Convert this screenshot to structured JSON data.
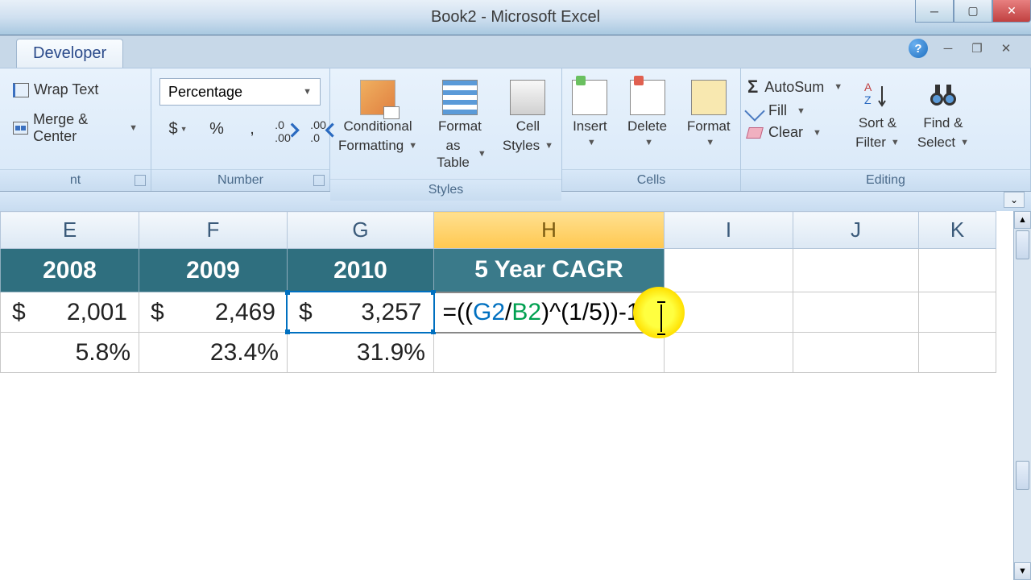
{
  "titlebar": {
    "text": "Book2 - Microsoft Excel"
  },
  "tab": {
    "label": "Developer"
  },
  "ribbon": {
    "alignment": {
      "wrap": "Wrap Text",
      "merge": "Merge & Center",
      "label": "nt"
    },
    "number": {
      "format": "Percentage",
      "dollar": "$",
      "percent": "%",
      "comma": ",",
      "inc": ".0→.00",
      "dec": ".00→.0",
      "label": "Number"
    },
    "styles": {
      "cond1": "Conditional",
      "cond2": "Formatting",
      "fmt1": "Format",
      "fmt2": "as Table",
      "cell1": "Cell",
      "cell2": "Styles",
      "label": "Styles"
    },
    "cells": {
      "insert": "Insert",
      "delete": "Delete",
      "format": "Format",
      "label": "Cells"
    },
    "editing": {
      "autosum": "AutoSum",
      "fill": "Fill",
      "clear": "Clear",
      "sort1": "Sort &",
      "sort2": "Filter",
      "find1": "Find &",
      "find2": "Select",
      "label": "Editing"
    }
  },
  "columns": {
    "E": "E",
    "F": "F",
    "G": "G",
    "H": "H",
    "I": "I",
    "J": "J",
    "K": "K"
  },
  "headers": {
    "E": "2008",
    "F": "2009",
    "G": "2010",
    "H": "5 Year CAGR"
  },
  "row2": {
    "E_sym": "$",
    "E_val": "2,001",
    "F_sym": "$",
    "F_val": "2,469",
    "G_sym": "$",
    "G_val": "3,257",
    "H_formula_prefix": "=((",
    "H_formula_g": "G2",
    "H_formula_slash": "/",
    "H_formula_b": "B2",
    "H_formula_mid": ")^(1/5))",
    "H_formula_suffix": "-1"
  },
  "row3": {
    "E": "5.8%",
    "F": "23.4%",
    "G": "31.9%"
  },
  "chart_data": {
    "type": "table",
    "columns": [
      "E",
      "F",
      "G",
      "H"
    ],
    "header_row": [
      "2008",
      "2009",
      "2010",
      "5 Year CAGR"
    ],
    "data_rows": [
      {
        "E": 2001,
        "F": 2469,
        "G": 3257,
        "H": "=((G2/B2)^(1/5))-1"
      },
      {
        "E": 0.058,
        "F": 0.234,
        "G": 0.319,
        "H": null
      }
    ],
    "active_cell": "H2",
    "number_format": "Percentage"
  }
}
